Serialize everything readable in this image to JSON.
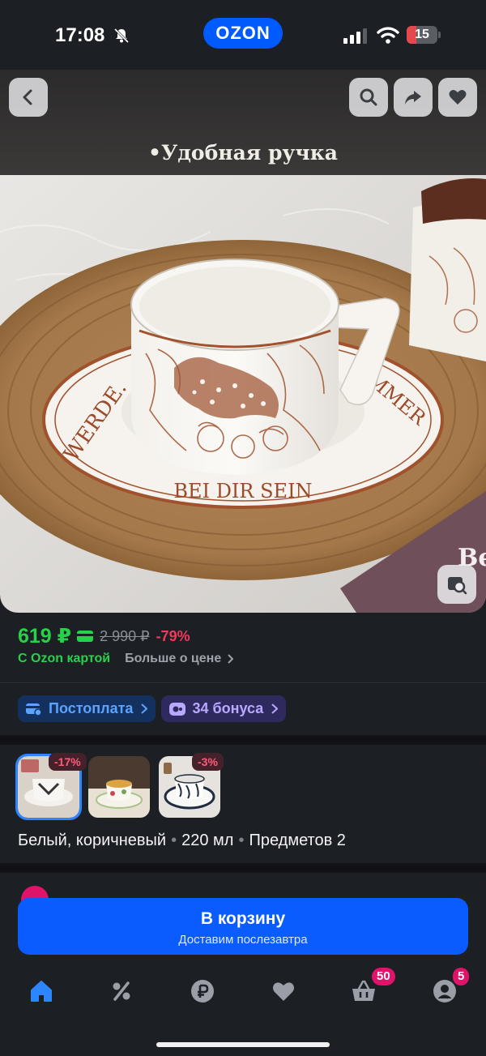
{
  "status_bar": {
    "time": "17:08",
    "battery": "15"
  },
  "brand": {
    "logo_text": "OZON",
    "accent": "#005bff"
  },
  "gallery": {
    "caption": "•Удобная ручка",
    "saucer_text_left": "WERDE.",
    "saucer_text_right": "MMER",
    "saucer_text_bottom": "BEI DIR SEIN",
    "card_text": "Be",
    "icons": [
      "back-icon",
      "search-icon",
      "share-icon",
      "heart-icon",
      "similar-search-icon"
    ]
  },
  "price": {
    "current": "619 ₽",
    "old": "2 990 ₽",
    "discount": "-79%",
    "ozon_card_label": "С Ozon картой",
    "more_label": "Больше о цене"
  },
  "chips": {
    "postpay": "Постоплата",
    "bonus": "34 бонуса"
  },
  "variants": {
    "badges": [
      "-17%",
      "-3%"
    ],
    "description": {
      "color": "Белый, коричневый",
      "volume": "220 мл",
      "items": "Предметов 2"
    }
  },
  "cart": {
    "label": "В корзину",
    "sub": "Доставим послезавтра"
  },
  "tabbar": {
    "cart_count": "50",
    "profile_count": "5",
    "icons": [
      "home-icon",
      "percent-icon",
      "ruble-icon",
      "heart-icon",
      "basket-icon",
      "profile-icon"
    ]
  },
  "colors": {
    "price_green": "#27d24a",
    "discount_red": "#f2395d",
    "button_blue": "#0a5cff",
    "badge_pink": "#e0136b"
  }
}
